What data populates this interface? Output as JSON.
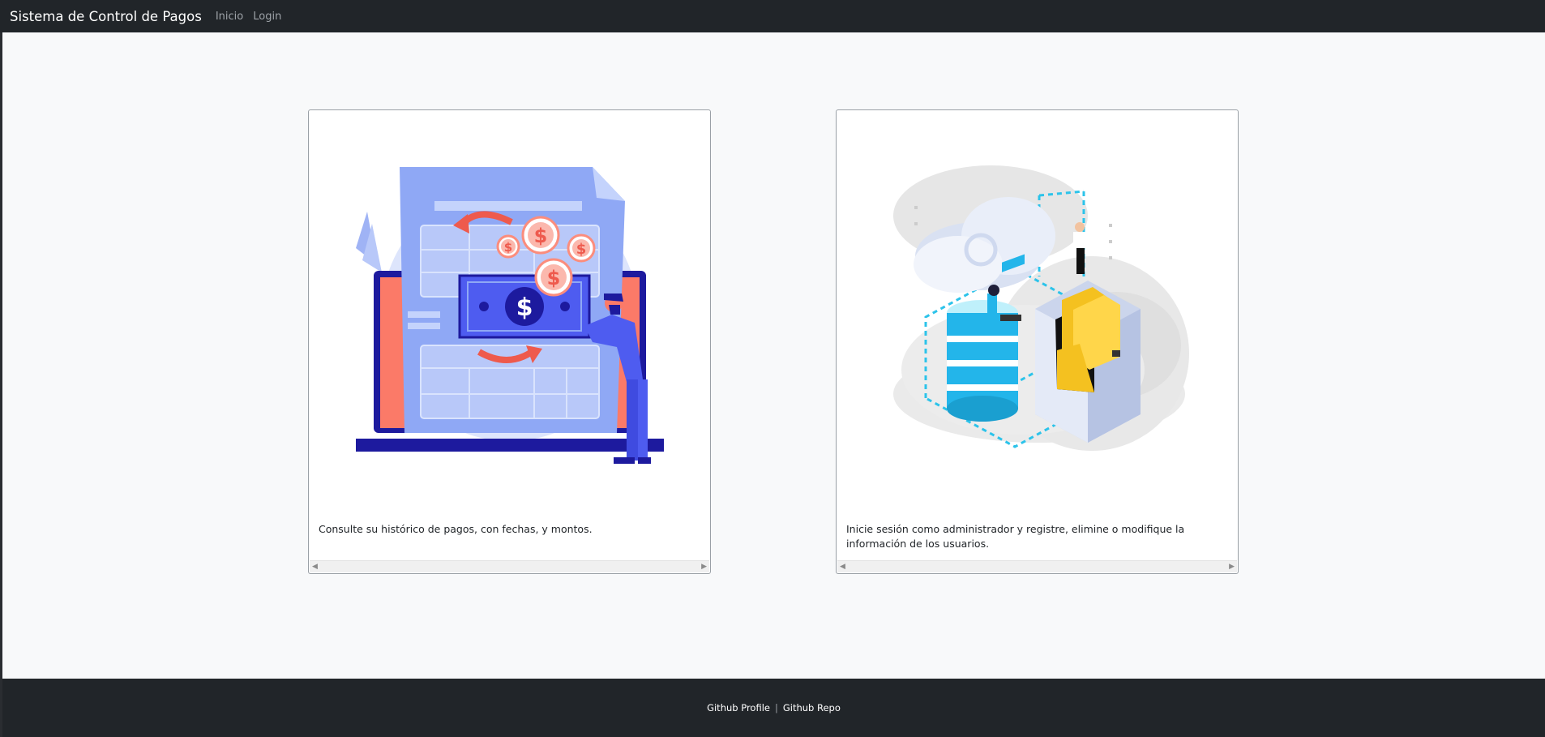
{
  "navbar": {
    "brand": "Sistema de Control de Pagos",
    "links": [
      {
        "label": "Inicio"
      },
      {
        "label": "Login"
      }
    ]
  },
  "cards": [
    {
      "illustration": "payment-history-illustration",
      "text": "Consulte su histórico de pagos, con fechas, y montos."
    },
    {
      "illustration": "database-admin-illustration",
      "text": "Inicie sesión como administrador y registre, elimine o modifique la información de los usuarios."
    }
  ],
  "footer": {
    "links": [
      {
        "label": "Github Profile"
      },
      {
        "label": "Github Repo"
      }
    ],
    "separator": "|"
  },
  "colors": {
    "navbar": "#212529",
    "page_background": "#f8f9fa",
    "illustration_blue": "#4e5cf0",
    "illustration_red": "#ee5a4d",
    "illustration_cyan": "#23b5ea",
    "illustration_yellow": "#f4c120"
  }
}
